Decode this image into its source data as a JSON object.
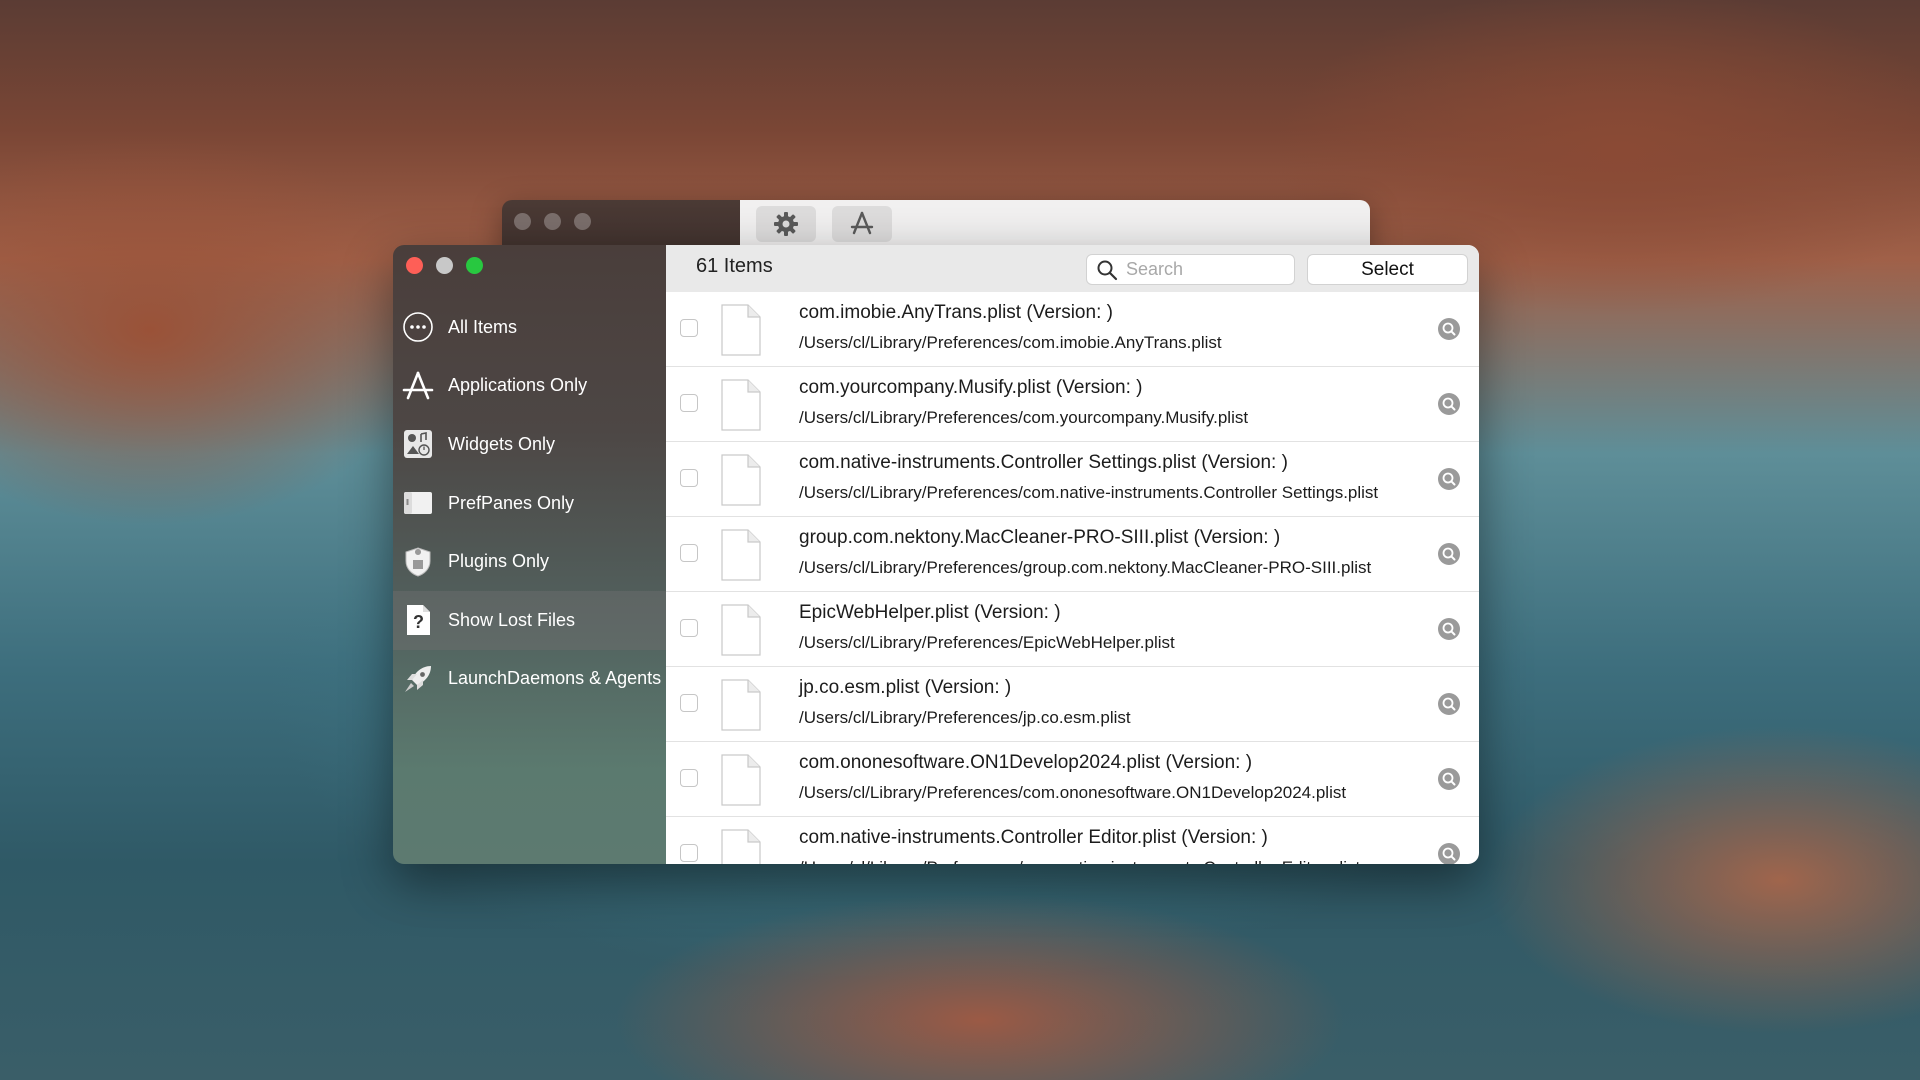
{
  "back_window": {
    "toolbar_icons": [
      "gear-icon",
      "app-store-icon"
    ]
  },
  "sidebar": {
    "items": [
      {
        "label": "All Items",
        "icon": "ellipsis-circle-icon",
        "active": false
      },
      {
        "label": "Applications Only",
        "icon": "app-store-icon",
        "active": false
      },
      {
        "label": "Widgets Only",
        "icon": "widget-icon",
        "active": false
      },
      {
        "label": "PrefPanes Only",
        "icon": "prefpane-icon",
        "active": false
      },
      {
        "label": "Plugins Only",
        "icon": "plugin-shield-icon",
        "active": false
      },
      {
        "label": "Show Lost Files",
        "icon": "question-file-icon",
        "active": true
      },
      {
        "label": "LaunchDaemons & Agents",
        "icon": "rocket-icon",
        "active": false
      }
    ]
  },
  "header": {
    "item_count": "61 Items",
    "search_placeholder": "Search",
    "select_label": "Select"
  },
  "files": [
    {
      "title": "com.imobie.AnyTrans.plist (Version: )",
      "path": "/Users/cl/Library/Preferences/com.imobie.AnyTrans.plist"
    },
    {
      "title": "com.yourcompany.Musify.plist (Version: )",
      "path": "/Users/cl/Library/Preferences/com.yourcompany.Musify.plist"
    },
    {
      "title": "com.native-instruments.Controller Settings.plist (Version: )",
      "path": "/Users/cl/Library/Preferences/com.native-instruments.Controller Settings.plist"
    },
    {
      "title": "group.com.nektony.MacCleaner-PRO-SIII.plist (Version: )",
      "path": "/Users/cl/Library/Preferences/group.com.nektony.MacCleaner-PRO-SIII.plist"
    },
    {
      "title": "EpicWebHelper.plist (Version: )",
      "path": "/Users/cl/Library/Preferences/EpicWebHelper.plist"
    },
    {
      "title": "jp.co.esm.plist (Version: )",
      "path": "/Users/cl/Library/Preferences/jp.co.esm.plist"
    },
    {
      "title": "com.ononesoftware.ON1Develop2024.plist (Version: )",
      "path": "/Users/cl/Library/Preferences/com.ononesoftware.ON1Develop2024.plist"
    },
    {
      "title": "com.native-instruments.Controller Editor.plist (Version: )",
      "path": "/Users/cl/Library/Preferences/com.native-instruments.Controller Editor.plist"
    }
  ],
  "colors": {
    "close": "#fe5f57",
    "minimize": "#c8c8c8",
    "zoom": "#28c840"
  }
}
